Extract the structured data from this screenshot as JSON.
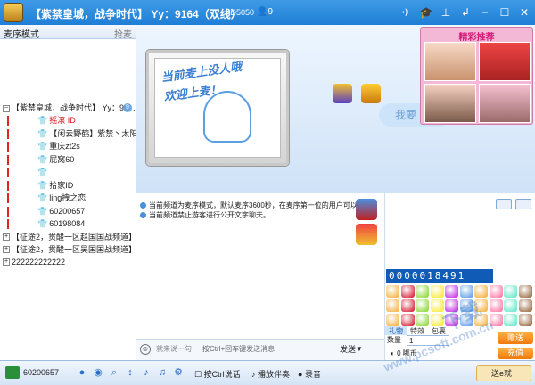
{
  "title": {
    "room_name": "【紫禁皇城，战争时代】",
    "yy_label": "Yy：9164（双线）",
    "id_label": "ID5050",
    "member_count": "9"
  },
  "left": {
    "mode": "麦序模式",
    "mode_action": "抢麦",
    "channel_root": "【紫禁皇城，战争时代】 Yy：9 1 ...",
    "channel_root_badge": "9",
    "users": [
      {
        "name": "摇滚 ID",
        "red": true
      },
      {
        "name": "【闲云野鹤】紫禁丶太阳",
        "red": false
      },
      {
        "name": "重庆zt2s",
        "red": false
      },
      {
        "name": "屁窝60",
        "red": false
      },
      {
        "name": "",
        "red": false
      },
      {
        "name": "拾家ID",
        "red": false
      },
      {
        "name": "ling拽之恋",
        "red": false
      },
      {
        "name": "60200657",
        "red": false
      },
      {
        "name": "60198084",
        "red": false
      }
    ],
    "subchannels": [
      "【征途2，贯酸一区赵国国战频道】",
      "【征途2，贯酸一区吴国国战频道】",
      "222222222222"
    ]
  },
  "stage": {
    "screen_line1": "当前麦上没人哦",
    "screen_line2": "欢迎上麦！",
    "promo_title": "精彩推荐",
    "side_pill": "我要"
  },
  "chat": {
    "messages": [
      "当前频道为麦序模式，默认麦序3600秒，在麦序第一位的用户可以发言。",
      "当前频道禁止游客进行公开文字聊天。"
    ],
    "input_placeholder": "就来说一句",
    "input_hint": "按Ctrl+回车键发送消息",
    "send_label": "发送",
    "send_arrow": "▼"
  },
  "gift": {
    "digits": "0000018491",
    "tabs": [
      "礼物",
      "特效",
      "包裹"
    ],
    "qty_label": "数量",
    "qty_value": "1",
    "coin_value": "0",
    "coin_unit": "嘟币",
    "give_label": "赠送",
    "recharge_label": "充值"
  },
  "bottom": {
    "user_id": "60200657",
    "ctrl_talk": "按Ctrl说话",
    "music": "播放伴奏",
    "record": "录音",
    "treasure": "送e就"
  },
  "watermark": {
    "brand": "下载",
    "url": "www.pcsoft.com.cn"
  },
  "colors": {
    "titlebar": "#1f7fd6",
    "accent_orange": "#f07a0a",
    "promo_pink": "#f2b8d6",
    "red_name": "#d41919"
  }
}
